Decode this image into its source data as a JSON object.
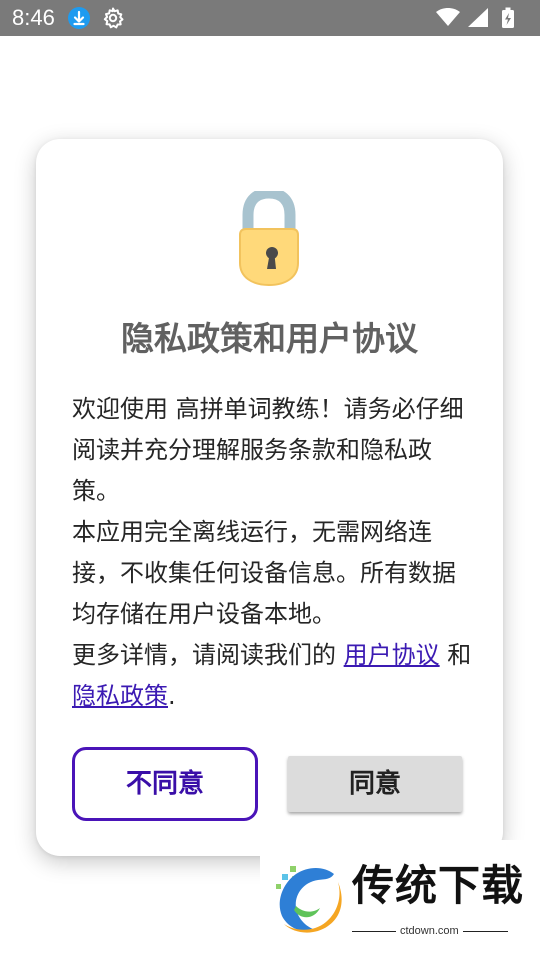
{
  "status_bar": {
    "time": "8:46",
    "icons": [
      "download-icon",
      "gear-icon",
      "wifi-icon",
      "signal-icon",
      "battery-charging-icon"
    ],
    "background": "#7a7a7a"
  },
  "dialog": {
    "icon": "lock-icon",
    "title": "隐私政策和用户协议",
    "body_intro": "欢迎使用 高拼单词教练！请务必仔细阅读并充分理解服务条款和隐私政策。",
    "body_offline": "本应用完全离线运行，无需网络连接，不收集任何设备信息。所有数据均存储在用户设备本地。",
    "body_more": "更多详情，请阅读我们的 ",
    "user_agreement_link": "用户协议",
    "and_text": " 和 ",
    "privacy_policy_link": "隐私政策",
    "period": ".",
    "disagree_label": "不同意",
    "agree_label": "同意"
  },
  "colors": {
    "accent": "#4a14b8",
    "link": "#3b1ab3",
    "title": "#616161",
    "agree_button_bg": "#dcdcdc"
  },
  "watermark": {
    "brand": "传统下载",
    "site": "ctdown.com"
  }
}
